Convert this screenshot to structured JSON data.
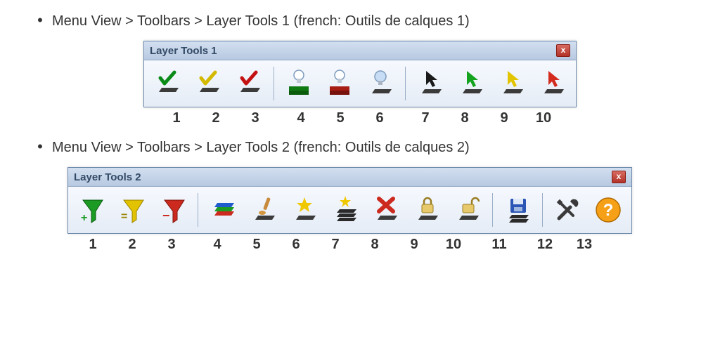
{
  "bullets": {
    "b1": "Menu View > Toolbars > Layer Tools 1 (french: Outils de calques 1)",
    "b2": "Menu View > Toolbars > Layer Tools 2 (french: Outils de calques 2)"
  },
  "toolbar1": {
    "title": "Layer Tools 1",
    "close": "x",
    "icons": [
      "check-green-layer",
      "check-yellow-layer",
      "check-red-layer",
      "bulb-green-layer",
      "bulb-red-layer",
      "bulb-off-layer",
      "cursor-black-layer",
      "cursor-green-layer",
      "cursor-yellow-layer",
      "cursor-red-layer"
    ],
    "numbers": [
      "1",
      "2",
      "3",
      "4",
      "5",
      "6",
      "7",
      "8",
      "9",
      "10"
    ]
  },
  "toolbar2": {
    "title": "Layer Tools 2",
    "close": "x",
    "icons": [
      "funnel-green-plus",
      "funnel-yellow-equals",
      "funnel-red-minus",
      "rgb-layers",
      "brush-layer",
      "spark-new-layer",
      "spark-stack-layers",
      "delete-layer",
      "lock-layer",
      "unlock-layer",
      "save-layers",
      "tools-settings",
      "help"
    ],
    "numbers": [
      "1",
      "2",
      "3",
      "4",
      "5",
      "6",
      "7",
      "8",
      "9",
      "10",
      "11",
      "12",
      "13"
    ]
  }
}
